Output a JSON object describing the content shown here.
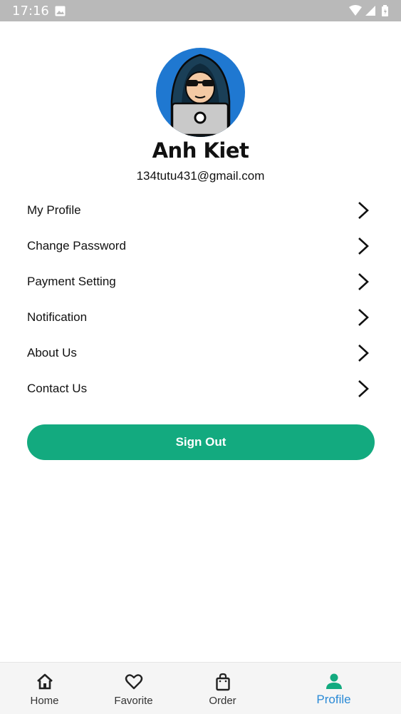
{
  "status_bar": {
    "time": "17:16",
    "icons": [
      "photo-icon",
      "wifi-icon",
      "signal-icon",
      "battery-icon"
    ]
  },
  "profile": {
    "name": "Anh Kiet",
    "email": "134tutu431@gmail.com",
    "avatar_icon": "hacker-avatar-icon"
  },
  "menu": {
    "items": [
      {
        "label": "My Profile"
      },
      {
        "label": "Change Password"
      },
      {
        "label": "Payment Setting"
      },
      {
        "label": "Notification"
      },
      {
        "label": "About Us"
      },
      {
        "label": "Contact Us"
      }
    ]
  },
  "signout": {
    "label": "Sign Out"
  },
  "bottom_nav": {
    "items": [
      {
        "label": "Home",
        "icon": "home-icon"
      },
      {
        "label": "Favorite",
        "icon": "heart-icon"
      },
      {
        "label": "Order",
        "icon": "shopping-bag-icon"
      },
      {
        "label": "Profile",
        "icon": "person-icon",
        "active": true
      }
    ]
  },
  "colors": {
    "accent": "#13aa7f",
    "active_nav": "#2a8ad6",
    "status_bar": "#b9b9b9",
    "avatar_bg": "#1f78d1"
  }
}
